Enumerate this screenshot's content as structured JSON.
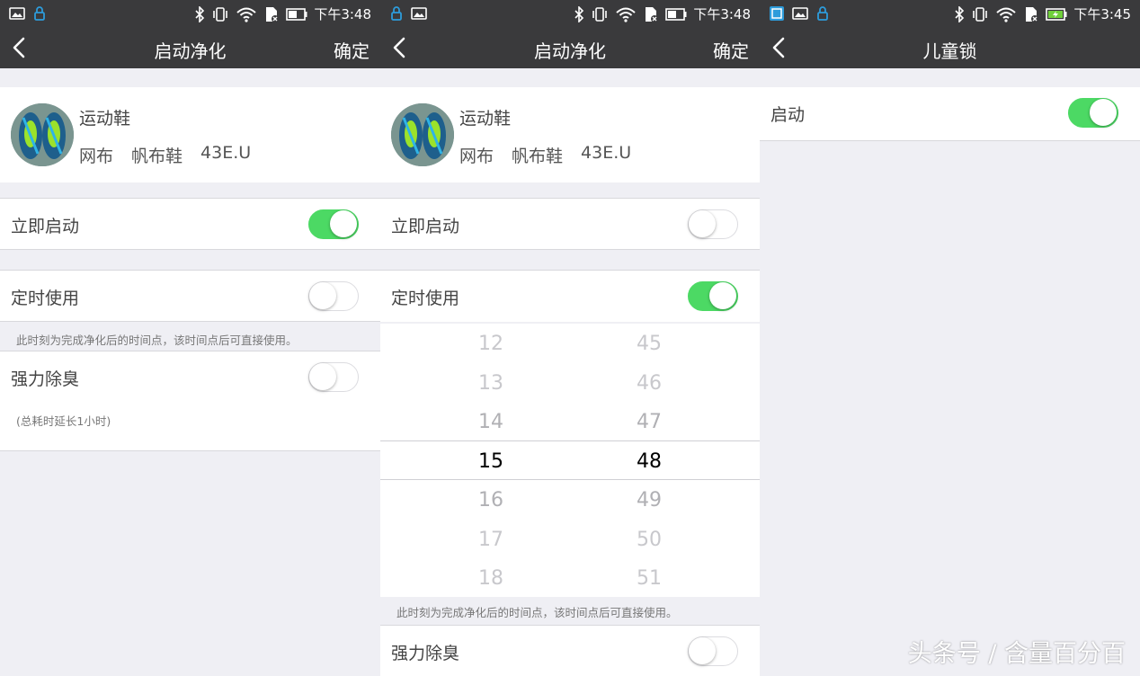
{
  "screens": [
    {
      "status": {
        "time": "下午3:48"
      },
      "nav": {
        "title": "启动净化",
        "confirm": "确定"
      },
      "product": {
        "name": "运动鞋",
        "tags": [
          "网布",
          "帆布鞋",
          "43E.U"
        ]
      },
      "rows": {
        "start_now": "立即启动",
        "timer": "定时使用",
        "deodorize": "强力除臭"
      },
      "toggles": {
        "start_now": true,
        "timer": false,
        "deodorize": false
      },
      "note_timer": "此时刻为完成净化后的时间点，该时间点后可直接使用。",
      "note_deodorize": "(总耗时延长1小时)"
    },
    {
      "status": {
        "time": "下午3:48"
      },
      "nav": {
        "title": "启动净化",
        "confirm": "确定"
      },
      "product": {
        "name": "运动鞋",
        "tags": [
          "网布",
          "帆布鞋",
          "43E.U"
        ]
      },
      "rows": {
        "start_now": "立即启动",
        "timer": "定时使用",
        "deodorize": "强力除臭"
      },
      "toggles": {
        "start_now": false,
        "timer": true,
        "deodorize": false
      },
      "picker": {
        "hours": [
          "12",
          "13",
          "14",
          "15",
          "16",
          "17",
          "18"
        ],
        "minutes": [
          "45",
          "46",
          "47",
          "48",
          "49",
          "50",
          "51"
        ],
        "selected_hour": "15",
        "selected_minute": "48"
      },
      "note_timer": "此时刻为完成净化后的时间点，该时间点后可直接使用。"
    },
    {
      "status": {
        "time": "下午3:45"
      },
      "nav": {
        "title": "儿童锁"
      },
      "rows": {
        "enable": "启动"
      },
      "toggles": {
        "enable": true
      }
    }
  ],
  "watermark": "头条号 / 含量百分百",
  "colors": {
    "bar": "#3a3a3c",
    "toggle_on": "#4cd964",
    "background": "#efeff4"
  }
}
